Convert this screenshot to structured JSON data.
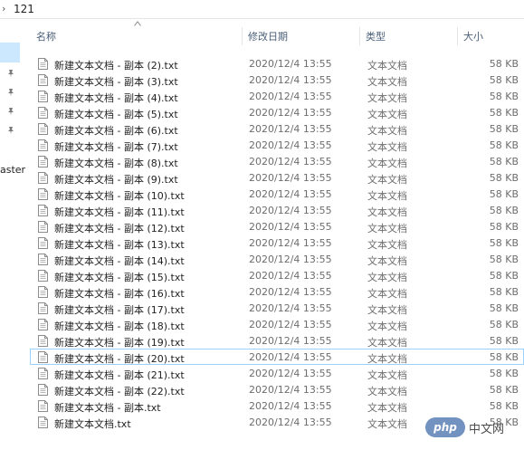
{
  "breadcrumb": {
    "chevron": "›",
    "folder": "121"
  },
  "nav": {
    "partial_label": "aster"
  },
  "columns": {
    "name": "名称",
    "date": "修改日期",
    "type": "类型",
    "size": "大小"
  },
  "sort": {
    "column": "name",
    "direction": "up"
  },
  "files": [
    {
      "name": "新建文本文档 - 副本 (2).txt",
      "date": "2020/12/4 13:55",
      "type": "文本文档",
      "size": "58 KB"
    },
    {
      "name": "新建文本文档 - 副本 (3).txt",
      "date": "2020/12/4 13:55",
      "type": "文本文档",
      "size": "58 KB"
    },
    {
      "name": "新建文本文档 - 副本 (4).txt",
      "date": "2020/12/4 13:55",
      "type": "文本文档",
      "size": "58 KB"
    },
    {
      "name": "新建文本文档 - 副本 (5).txt",
      "date": "2020/12/4 13:55",
      "type": "文本文档",
      "size": "58 KB"
    },
    {
      "name": "新建文本文档 - 副本 (6).txt",
      "date": "2020/12/4 13:55",
      "type": "文本文档",
      "size": "58 KB"
    },
    {
      "name": "新建文本文档 - 副本 (7).txt",
      "date": "2020/12/4 13:55",
      "type": "文本文档",
      "size": "58 KB"
    },
    {
      "name": "新建文本文档 - 副本 (8).txt",
      "date": "2020/12/4 13:55",
      "type": "文本文档",
      "size": "58 KB"
    },
    {
      "name": "新建文本文档 - 副本 (9).txt",
      "date": "2020/12/4 13:55",
      "type": "文本文档",
      "size": "58 KB"
    },
    {
      "name": "新建文本文档 - 副本 (10).txt",
      "date": "2020/12/4 13:55",
      "type": "文本文档",
      "size": "58 KB"
    },
    {
      "name": "新建文本文档 - 副本 (11).txt",
      "date": "2020/12/4 13:55",
      "type": "文本文档",
      "size": "58 KB"
    },
    {
      "name": "新建文本文档 - 副本 (12).txt",
      "date": "2020/12/4 13:55",
      "type": "文本文档",
      "size": "58 KB"
    },
    {
      "name": "新建文本文档 - 副本 (13).txt",
      "date": "2020/12/4 13:55",
      "type": "文本文档",
      "size": "58 KB"
    },
    {
      "name": "新建文本文档 - 副本 (14).txt",
      "date": "2020/12/4 13:55",
      "type": "文本文档",
      "size": "58 KB"
    },
    {
      "name": "新建文本文档 - 副本 (15).txt",
      "date": "2020/12/4 13:55",
      "type": "文本文档",
      "size": "58 KB"
    },
    {
      "name": "新建文本文档 - 副本 (16).txt",
      "date": "2020/12/4 13:55",
      "type": "文本文档",
      "size": "58 KB"
    },
    {
      "name": "新建文本文档 - 副本 (17).txt",
      "date": "2020/12/4 13:55",
      "type": "文本文档",
      "size": "58 KB"
    },
    {
      "name": "新建文本文档 - 副本 (18).txt",
      "date": "2020/12/4 13:55",
      "type": "文本文档",
      "size": "58 KB"
    },
    {
      "name": "新建文本文档 - 副本 (19).txt",
      "date": "2020/12/4 13:55",
      "type": "文本文档",
      "size": "58 KB"
    },
    {
      "name": "新建文本文档 - 副本 (20).txt",
      "date": "2020/12/4 13:55",
      "type": "文本文档",
      "size": "58 KB",
      "focused": true
    },
    {
      "name": "新建文本文档 - 副本 (21).txt",
      "date": "2020/12/4 13:55",
      "type": "文本文档",
      "size": "58 KB"
    },
    {
      "name": "新建文本文档 - 副本 (22).txt",
      "date": "2020/12/4 13:55",
      "type": "文本文档",
      "size": "58 KB"
    },
    {
      "name": "新建文本文档 - 副本.txt",
      "date": "2020/12/4 13:55",
      "type": "文本文档",
      "size": "58 KB"
    },
    {
      "name": "新建文本文档.txt",
      "date": "2020/12/4 13:55",
      "type": "文本文档",
      "size": "58 KB"
    }
  ],
  "watermark": {
    "logo": "php",
    "text": "中文网"
  },
  "colors": {
    "selection": "#cce8ff",
    "focus_border": "#99d1ff",
    "header_text": "#4c607a"
  }
}
